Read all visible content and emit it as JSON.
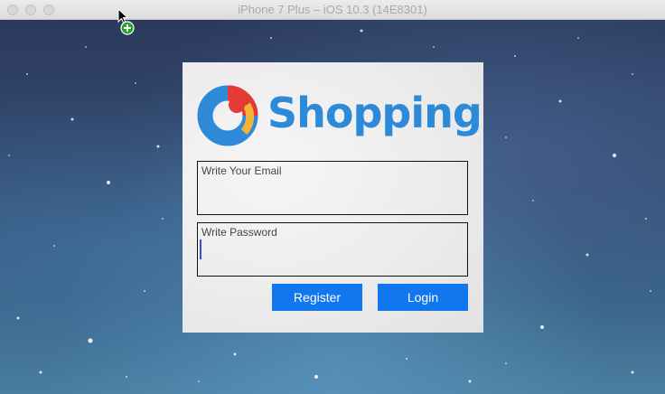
{
  "window": {
    "title": "iPhone 7 Plus – iOS 10.3 (14E8301)"
  },
  "app": {
    "brand": "Shopping",
    "email_placeholder": "Write Your Email",
    "password_placeholder": "Write Password",
    "register_label": "Register",
    "login_label": "Login"
  },
  "colors": {
    "brand_blue": "#2c8ad8",
    "button_blue": "#1177ee"
  },
  "icons": {
    "cursor": "arrow-cursor-with-add-badge"
  }
}
